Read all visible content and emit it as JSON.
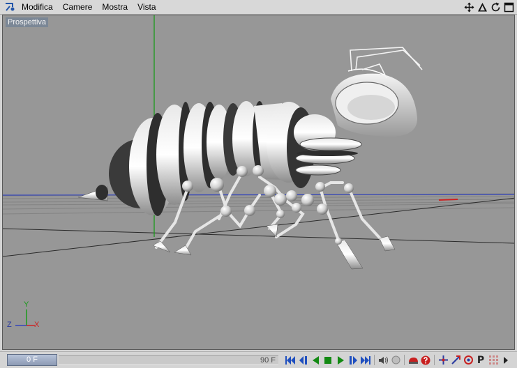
{
  "menubar": {
    "items": [
      "Modifica",
      "Camere",
      "Mostra",
      "Vista"
    ],
    "nav_icons": [
      "move-icon",
      "rotate-icon",
      "refresh-icon",
      "maximize-icon"
    ]
  },
  "viewport": {
    "label": "Prospettiva",
    "axis_labels": {
      "y": "Y",
      "z": "Z",
      "x": "X"
    }
  },
  "timeline": {
    "current_frame": "0 F",
    "end_frame": "90 F",
    "transport_icons": [
      "go-to-start-icon",
      "previous-key-icon",
      "play-backward-icon",
      "stop-icon",
      "play-forward-icon",
      "next-key-icon",
      "go-to-end-icon",
      "sound-icon",
      "record-icon",
      "keyframe-icon",
      "help-icon",
      "position-track-icon",
      "scale-track-icon",
      "rotation-track-icon",
      "parameter-track-icon",
      "grid-icon",
      "menu-arrow-icon"
    ],
    "param_label": "P"
  },
  "colors": {
    "viewport_bg": "#979797",
    "axis_green": "#1a9a1a",
    "axis_red": "#cc2222",
    "axis_blue": "#3344bb",
    "transport_blue": "#1f4fbf",
    "transport_green": "#138a13"
  }
}
